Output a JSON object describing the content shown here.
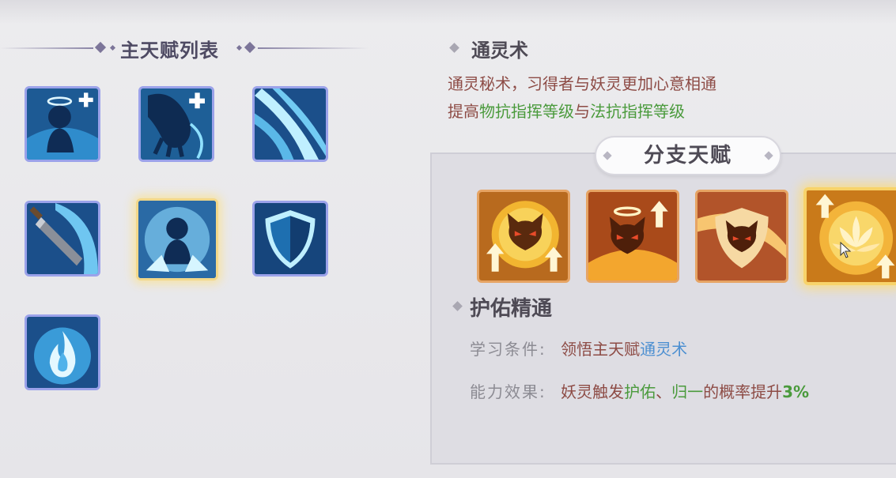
{
  "main_list": {
    "title": "主天赋列表",
    "talents": [
      {
        "icon": "angel-spirit-plus-icon"
      },
      {
        "icon": "claw-plus-icon"
      },
      {
        "icon": "wind-slash-icon"
      },
      {
        "icon": "sword-icon"
      },
      {
        "icon": "summon-spirit-icon",
        "selected": true
      },
      {
        "icon": "shield-icon"
      },
      {
        "icon": "blue-flame-icon"
      }
    ]
  },
  "detail": {
    "name": "通灵术",
    "description_line1": "通灵秘术，习得者与妖灵更加心意相通",
    "description_line2_prefix": "提高",
    "description_line2_hl1": "物抗指挥等级",
    "description_line2_mid": "与",
    "description_line2_hl2": "法抗指挥等级"
  },
  "branch": {
    "title": "分支天赋",
    "icons": [
      {
        "icon": "cat-orb-up-icon"
      },
      {
        "icon": "cat-halo-up-icon"
      },
      {
        "icon": "cat-shield-swirl-icon"
      },
      {
        "icon": "lotus-up-icon",
        "selected": true
      }
    ]
  },
  "skill": {
    "name": "护佑精通",
    "learn_label": "学习条件:",
    "learn_text_prefix": "领悟主天赋",
    "learn_text_link": "通灵术",
    "effect_label": "能力效果:",
    "effect_prefix": "妖灵触发",
    "effect_hl1": "护佑",
    "effect_sep": "、",
    "effect_hl2": "归一",
    "effect_mid": "的概率提升",
    "effect_value": "3%"
  },
  "colors": {
    "accent_green": "#4a9a3c",
    "accent_blue": "#4c8fd1",
    "text_brown": "#8d4b45",
    "main_icon_border": "#9ba2ea",
    "branch_icon_border": "#e6a464"
  }
}
